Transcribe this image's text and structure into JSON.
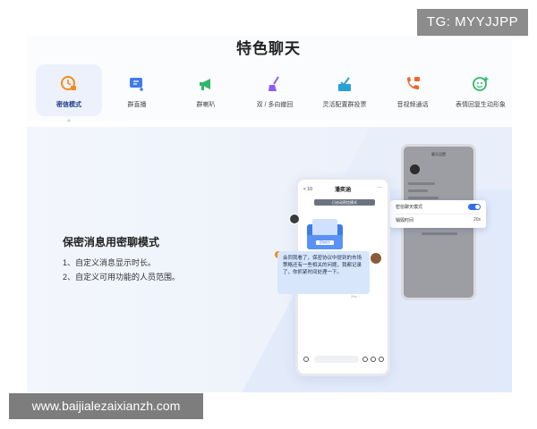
{
  "watermarks": {
    "top": "TG: MYYJJPP",
    "bottom": "www.baijialezaixianzh.com"
  },
  "page": {
    "title": "特色聊天"
  },
  "tabs": [
    {
      "label": "密信模式",
      "icon": "clock-lock-icon",
      "active": true
    },
    {
      "label": "群直播",
      "icon": "live-stream-icon",
      "active": false
    },
    {
      "label": "群喇叭",
      "icon": "megaphone-icon",
      "active": false
    },
    {
      "label": "双 / 多向撤回",
      "icon": "broom-icon",
      "active": false
    },
    {
      "label": "灵活配置群投票",
      "icon": "vote-icon",
      "active": false
    },
    {
      "label": "音视频通话",
      "icon": "phone-video-icon",
      "active": false
    },
    {
      "label": "表情回复生动形象",
      "icon": "emoji-add-icon",
      "active": false
    }
  ],
  "feature": {
    "title": "保密消息用密聊模式",
    "items": [
      "1、自定义消息显示时长。",
      "2、自定义可用功能的人员范围。"
    ]
  },
  "chat_phone": {
    "back_label": "< 10",
    "contact_name": "潘奕涵",
    "more": "···",
    "banner": "已启动密信模式",
    "envelope_label": "密信模式",
    "message": "会同我看了，保密协议中提到的市场策略还有一些相关的问题，我都记录了，你抓紧时间处理一下。",
    "timer": "25s ◌"
  },
  "settings_phone": {
    "title": "聊天设置",
    "popup": {
      "row1": "密信聊天模式",
      "row2": "销毁时间",
      "row2_value": "20s",
      "toggle_on": true
    }
  },
  "colors": {
    "accent": "#2f6fe6",
    "active_tab_bg": "#ecf1fb",
    "hero_bg": "#eef3fb",
    "bubble": "#d7e6fb"
  }
}
